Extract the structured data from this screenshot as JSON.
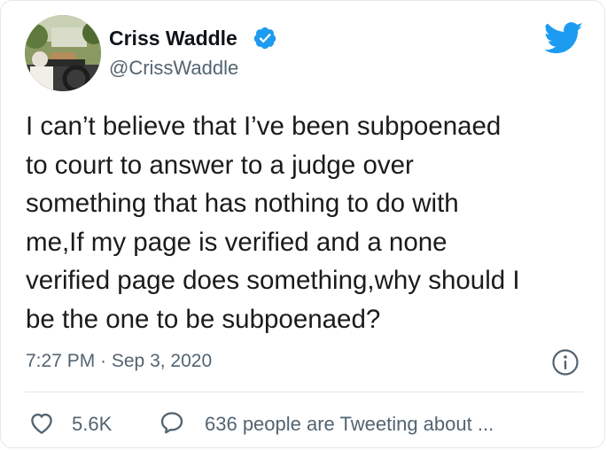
{
  "author": {
    "display_name": "Criss Waddle",
    "handle": "@CrissWaddle",
    "verified": true
  },
  "tweet": {
    "lines": [
      "I can’t believe that I’ve been subpoenaed",
      "to court to answer to a judge over",
      "something that has nothing to do with",
      "me,If my page is verified and a none",
      "verified page does something,why should I",
      "be the one to be subpoenaed?"
    ],
    "timestamp": "7:27 PM · Sep 3, 2020"
  },
  "actions": {
    "like_count": "5.6K",
    "tweeting_label": "636 people are Tweeting about ..."
  },
  "icons": {
    "verified": "verified-badge-icon",
    "brand": "twitter-bird-icon",
    "info": "info-icon",
    "like": "heart-icon",
    "reply": "speech-bubble-icon"
  },
  "colors": {
    "brand_blue": "#1d9bf0",
    "secondary_text": "#536471",
    "primary_text": "#0f1419",
    "border": "#e1e8ed"
  }
}
